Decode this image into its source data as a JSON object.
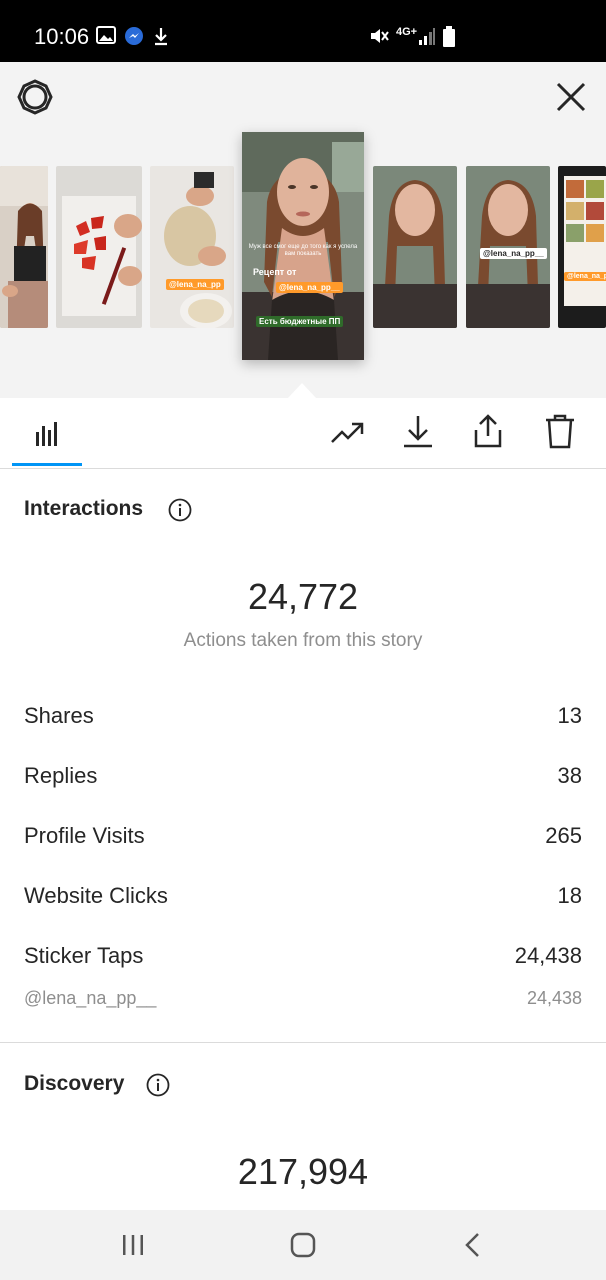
{
  "status_bar": {
    "time": "10:06",
    "network": "4G+",
    "icons": [
      "gallery-icon",
      "messenger-icon",
      "download-icon",
      "mute-icon",
      "signal-icon",
      "battery-icon"
    ]
  },
  "story_header": {
    "settings_icon": "gear-icon",
    "close_icon": "close-icon",
    "thumbnails": [
      {
        "sticker": ""
      },
      {
        "sticker": ""
      },
      {
        "sticker": "@lena_na_pp"
      },
      {
        "caption": "Муж все смог еще до того как я успела вам показать",
        "sticker_1": "Рецепт от",
        "sticker_2": "@lena_na_pp__",
        "sticker_3": "Есть бюджетные ПП"
      },
      {
        "sticker": ""
      },
      {
        "sticker": "@lena_na_pp__"
      },
      {
        "sticker": "@lena_na_pp"
      }
    ]
  },
  "toolbar": {
    "insights_icon": "bar-chart-icon",
    "promote_icon": "trending-up-icon",
    "download_icon": "download-icon",
    "share_icon": "share-icon",
    "delete_icon": "trash-icon",
    "accent_color": "#0095f6"
  },
  "interactions": {
    "title": "Interactions",
    "total": "24,772",
    "caption": "Actions taken from this story",
    "rows": [
      {
        "label": "Shares",
        "value": "13"
      },
      {
        "label": "Replies",
        "value": "38"
      },
      {
        "label": "Profile Visits",
        "value": "265"
      },
      {
        "label": "Website Clicks",
        "value": "18"
      },
      {
        "label": "Sticker Taps",
        "value": "24,438"
      }
    ],
    "sub_row": {
      "label": "@lena_na_pp__",
      "value": "24,438"
    }
  },
  "discovery": {
    "title": "Discovery",
    "total": "217,994"
  },
  "nav_bar": {
    "recents_icon": "recents-icon",
    "home_icon": "home-icon",
    "back_icon": "back-icon"
  }
}
